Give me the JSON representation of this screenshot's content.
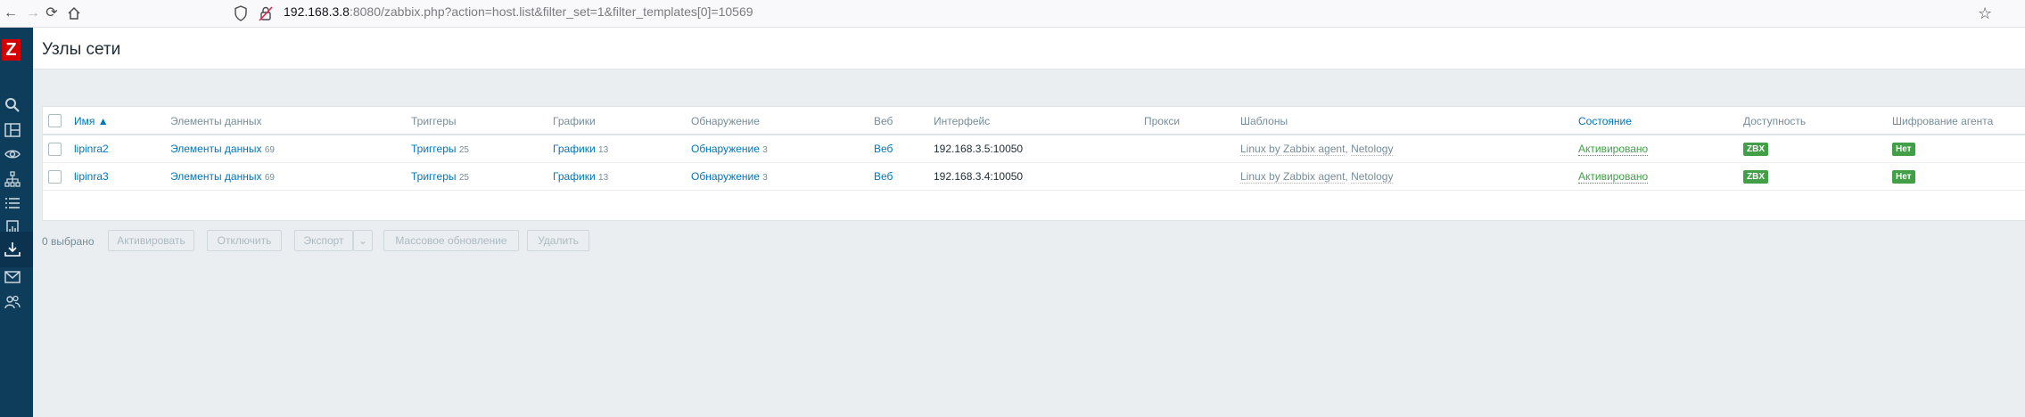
{
  "browser": {
    "url_host": "192.168.3.8",
    "url_rest": ":8080/zabbix.php?action=host.list&filter_set=1&filter_templates[0]=10569"
  },
  "app": {
    "logo": "Z",
    "page_title": "Узлы сети"
  },
  "table": {
    "headers": {
      "name": "Имя ▲",
      "items": "Элементы данных",
      "triggers": "Триггеры",
      "graphs": "Графики",
      "discovery": "Обнаружение",
      "web": "Веб",
      "interface": "Интерфейс",
      "proxy": "Прокси",
      "templates": "Шаблоны",
      "status": "Состояние",
      "availability": "Доступность",
      "encryption": "Шифрование агента"
    },
    "rows": [
      {
        "name": "lipinra2",
        "items_label": "Элементы данных",
        "items_count": "69",
        "triggers_label": "Триггеры",
        "triggers_count": "25",
        "graphs_label": "Графики",
        "graphs_count": "13",
        "discovery_label": "Обнаружение",
        "discovery_count": "3",
        "web": "Веб",
        "interface": "192.168.3.5:10050",
        "template1": "Linux by Zabbix agent",
        "template_sep": ", ",
        "template2": "Netology",
        "status": "Активировано",
        "availability": "ZBX",
        "encryption": "Нет"
      },
      {
        "name": "lipinra3",
        "items_label": "Элементы данных",
        "items_count": "69",
        "triggers_label": "Триггеры",
        "triggers_count": "25",
        "graphs_label": "Графики",
        "graphs_count": "13",
        "discovery_label": "Обнаружение",
        "discovery_count": "3",
        "web": "Веб",
        "interface": "192.168.3.4:10050",
        "template1": "Linux by Zabbix agent",
        "template_sep": ", ",
        "template2": "Netology",
        "status": "Активировано",
        "availability": "ZBX",
        "encryption": "Нет"
      }
    ]
  },
  "actions": {
    "selected": "0 выбрано",
    "activate": "Активировать",
    "disable": "Отключить",
    "export": "Экспорт",
    "export_dropdown": "⌄",
    "mass_update": "Массовое обновление",
    "delete": "Удалить"
  },
  "colors": {
    "sidebar": "#0e3c5b",
    "link": "#0275b8",
    "green": "#429e47",
    "logo": "#d40000"
  }
}
